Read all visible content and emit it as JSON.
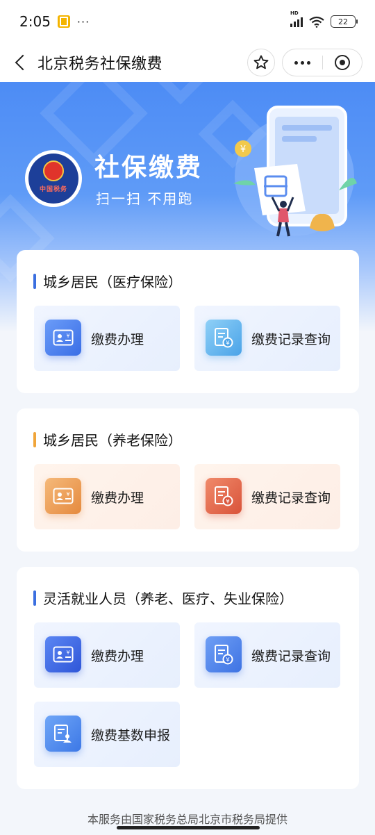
{
  "status": {
    "time": "2:05",
    "hd": "HD",
    "battery": "22"
  },
  "nav": {
    "title": "北京税务社保缴费"
  },
  "banner": {
    "title": "社保缴费",
    "subtitle": "扫一扫  不用跑",
    "emblem_text": "中国税务"
  },
  "sections": [
    {
      "title": "城乡居民（医疗保险）",
      "color": "#3b6fe0",
      "items": [
        {
          "label": "缴费办理",
          "icon": "id-card-icon"
        },
        {
          "label": "缴费记录查询",
          "icon": "receipt-icon"
        }
      ]
    },
    {
      "title": "城乡居民（养老保险）",
      "color": "#f0a53a",
      "items": [
        {
          "label": "缴费办理",
          "icon": "id-card-icon"
        },
        {
          "label": "缴费记录查询",
          "icon": "receipt-icon"
        }
      ]
    },
    {
      "title": "灵活就业人员（养老、医疗、失业保险）",
      "color": "#3b6fe0",
      "items": [
        {
          "label": "缴费办理",
          "icon": "id-card-icon"
        },
        {
          "label": "缴费记录查询",
          "icon": "receipt-icon"
        },
        {
          "label": "缴费基数申报",
          "icon": "declare-form-icon"
        }
      ]
    }
  ],
  "footer": "本服务由国家税务总局北京市税务局提供"
}
